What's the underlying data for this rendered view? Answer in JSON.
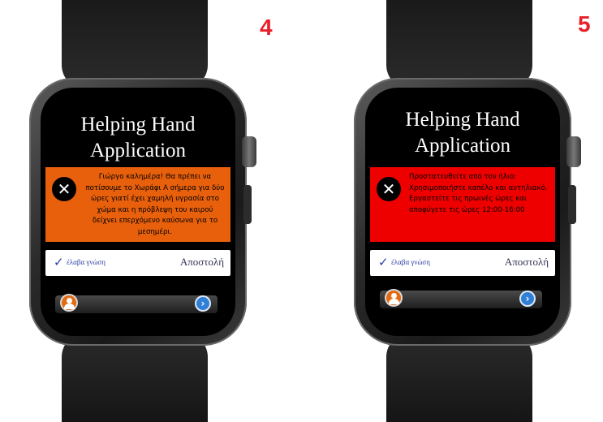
{
  "panels": [
    {
      "step_number": "4",
      "app_title_line1": "Helping Hand",
      "app_title_line2": "Application",
      "alert": {
        "color": "#e8600c",
        "icon": "close-x-icon",
        "message": "Γιώργο καλημέρα! Θα πρέπει να ποτίσουμε το Χωράφι Α σήμερα για δύο ώρες γιατί έχει χαμηλή υγρασία στο χώμα και η πρόβλεψη του καιρού δείχνει επερχόμενο καύσωνα για το μεσημέρι."
      },
      "ack_label": "έλαβα γνώση",
      "send_label": "Αποστολή"
    },
    {
      "step_number": "5",
      "app_title_line1": "Helping Hand",
      "app_title_line2": "Application",
      "alert": {
        "color": "#ee0000",
        "icon": "close-x-icon",
        "message": "Προστατευθείτε από τον ήλιο: Χρησιμοποιήστε καπέλο και αντηλιακό. Εργαστείτε τις πρωινές ώρες και αποφύγετε τις ώρες 12:00-16:00"
      },
      "ack_label": "έλαβα γνώση",
      "send_label": "Αποστολή"
    }
  ]
}
